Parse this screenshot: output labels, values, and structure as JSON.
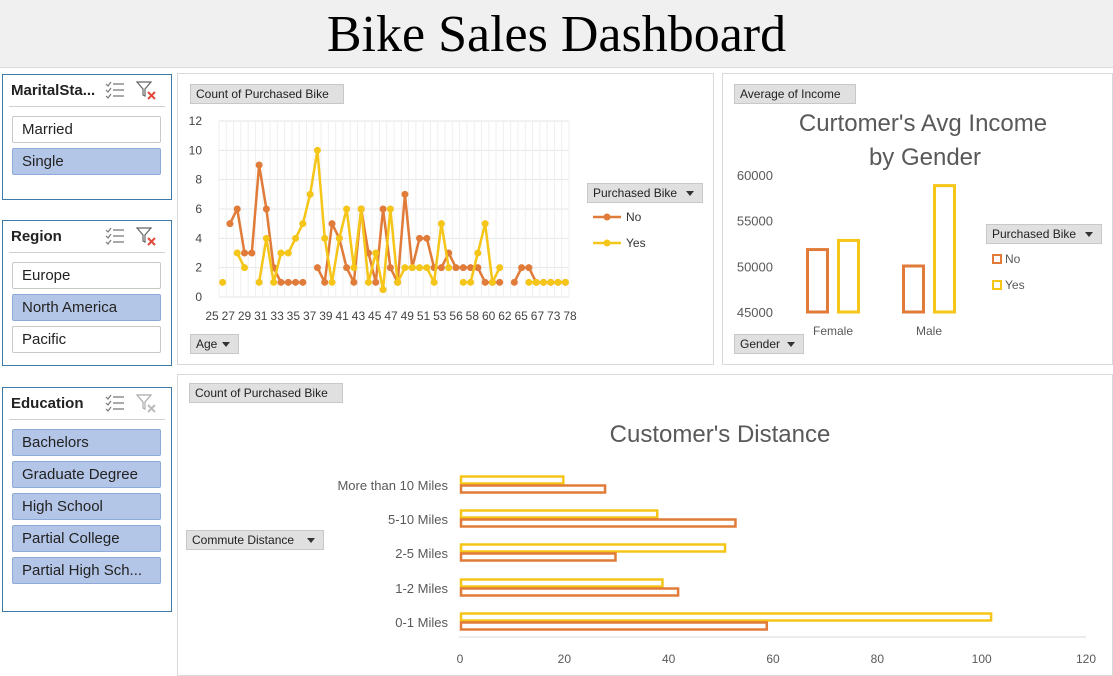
{
  "title": "Bike Sales Dashboard",
  "slicers": {
    "marital": {
      "title": "MaritalSta...",
      "items": [
        {
          "label": "Married",
          "selected": false
        },
        {
          "label": "Single",
          "selected": true
        }
      ]
    },
    "region": {
      "title": "Region",
      "items": [
        {
          "label": "Europe",
          "selected": false
        },
        {
          "label": "North America",
          "selected": true
        },
        {
          "label": "Pacific",
          "selected": false
        }
      ]
    },
    "education": {
      "title": "Education",
      "items": [
        {
          "label": "Bachelors",
          "selected": true
        },
        {
          "label": "Graduate Degree",
          "selected": true
        },
        {
          "label": "High School",
          "selected": true
        },
        {
          "label": "Partial College",
          "selected": true
        },
        {
          "label": "Partial High Sch...",
          "selected": true
        }
      ]
    }
  },
  "colors": {
    "no": "#e07b39",
    "yes": "#f5c518",
    "selected_item": "#b4c6e7",
    "slicer_border": "#3d7aa8",
    "clear_filter": "#e04a3a"
  },
  "age_panel": {
    "value_button": "Count of Purchased Bike",
    "axis_button": "Age",
    "legend_title": "Purchased Bike",
    "legend": [
      "No",
      "Yes"
    ]
  },
  "income_panel": {
    "value_button": "Average of Income",
    "axis_button": "Gender",
    "legend_title": "Purchased Bike",
    "legend": [
      "No",
      "Yes"
    ],
    "title_line1": "Curtomer's Avg Income",
    "title_line2": "by Gender"
  },
  "distance_panel": {
    "value_button": "Count of Purchased Bike",
    "axis_button": "Commute Distance",
    "title": "Customer's Distance"
  },
  "chart_data": [
    {
      "type": "line",
      "ylim": [
        0,
        12
      ],
      "yticks": [
        0,
        2,
        4,
        6,
        8,
        10,
        12
      ],
      "x_ticklabels": [
        "25",
        "27",
        "29",
        "31",
        "33",
        "35",
        "37",
        "39",
        "41",
        "43",
        "45",
        "47",
        "49",
        "51",
        "53",
        "56",
        "58",
        "60",
        "62",
        "65",
        "67",
        "73",
        "78"
      ],
      "grid": true,
      "legend_position": "right",
      "series": [
        {
          "name": "No",
          "values": [
            null,
            5,
            6,
            3,
            3,
            9,
            6,
            2,
            1,
            1,
            1,
            1,
            null,
            2,
            1,
            5,
            4,
            2,
            1,
            6,
            3,
            1,
            6,
            2,
            1,
            7,
            2,
            4,
            4,
            2,
            2,
            3,
            2,
            2,
            2,
            2,
            1,
            1,
            1,
            null,
            1,
            2,
            2,
            1,
            1,
            1,
            1,
            1
          ]
        },
        {
          "name": "Yes",
          "values": [
            1,
            null,
            3,
            2,
            null,
            1,
            4,
            1,
            3,
            3,
            4,
            5,
            7,
            10,
            4,
            1,
            4,
            6,
            2,
            6,
            1,
            3,
            0.5,
            6,
            1,
            2,
            2,
            2,
            2,
            1,
            5,
            2,
            null,
            1,
            1,
            3,
            5,
            1,
            2,
            null,
            null,
            null,
            1,
            1,
            1,
            1,
            1,
            1
          ]
        }
      ]
    },
    {
      "type": "bar",
      "categories": [
        "Female",
        "Male"
      ],
      "ylim": [
        45000,
        60000
      ],
      "yticks": [
        45000,
        50000,
        55000,
        60000
      ],
      "legend_position": "right",
      "series": [
        {
          "name": "No",
          "values": [
            52000,
            50200
          ]
        },
        {
          "name": "Yes",
          "values": [
            53000,
            59000
          ]
        }
      ]
    },
    {
      "type": "bar",
      "orientation": "horizontal",
      "categories": [
        "More than 10 Miles",
        "5-10 Miles",
        "2-5 Miles",
        "1-2 Miles",
        "0-1 Miles"
      ],
      "xlim": [
        0,
        120
      ],
      "xticks": [
        0,
        20,
        40,
        60,
        80,
        100,
        120
      ],
      "series": [
        {
          "name": "Yes",
          "values": [
            20,
            38,
            51,
            39,
            102
          ]
        },
        {
          "name": "No",
          "values": [
            28,
            53,
            30,
            42,
            59
          ]
        }
      ]
    }
  ]
}
